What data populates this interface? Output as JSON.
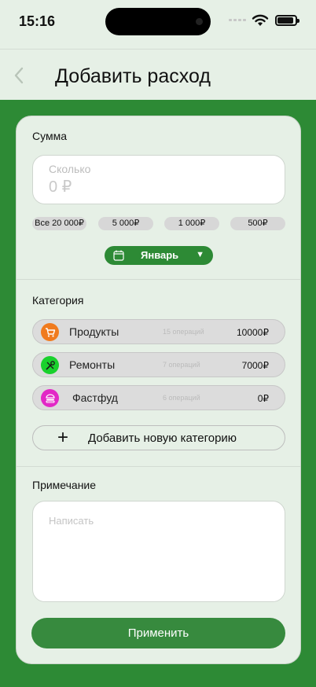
{
  "status": {
    "time": "15:16"
  },
  "nav": {
    "title": "Добавить расход"
  },
  "amount": {
    "label": "Сумма",
    "placeholder": "Сколько",
    "value": "0 ₽",
    "chips": [
      "Все 20 000₽",
      "5 000₽",
      "1 000₽",
      "500₽"
    ]
  },
  "month": {
    "label": "Январь",
    "arrow": "▼"
  },
  "categories": {
    "label": "Категория",
    "items": [
      {
        "name": "Продукты",
        "ops": "15 операций",
        "sum": "10000₽",
        "color": "#f07b1e",
        "icon": "cart-icon"
      },
      {
        "name": "Ремонты",
        "ops": "7 операций",
        "sum": "7000₽",
        "color": "#19d12d",
        "icon": "tools-icon"
      },
      {
        "name": "Фастфуд",
        "ops": "6 операций",
        "sum": "0₽",
        "color": "#e228c6",
        "icon": "burger-icon"
      }
    ],
    "add_label": "Добавить новую категорию",
    "add_icon": "+"
  },
  "note": {
    "label": "Примечание",
    "placeholder": "Написать"
  },
  "apply": {
    "label": "Применить"
  },
  "colors": {
    "accent": "#2d8a35",
    "surface": "#e6f0e6"
  }
}
